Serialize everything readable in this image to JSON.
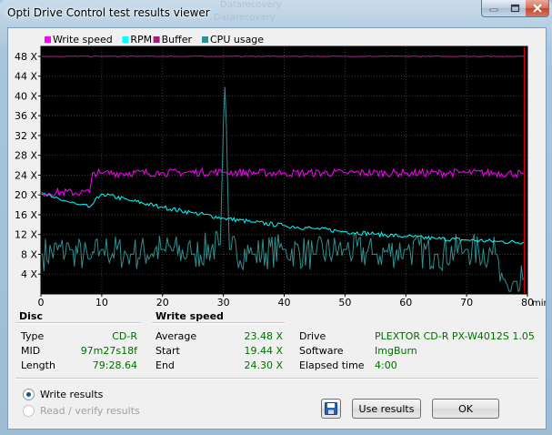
{
  "window": {
    "title": "Opti Drive Control test results viewer",
    "ghost_title_1": "Datarecovery",
    "ghost_title_2": "Datarecovery"
  },
  "chart": {
    "legend": [
      {
        "label": "Write speed",
        "color": "#ff00ff"
      },
      {
        "label": "RPM",
        "color": "#00ffff"
      },
      {
        "label": "Buffer",
        "color": "#a0207f"
      },
      {
        "label": "CPU usage",
        "color": "#2f8f8f"
      }
    ],
    "x_unit": "min",
    "background": "#000000",
    "grid_color": "#3a3a3a",
    "marker_color": "#ff0000"
  },
  "chart_data": {
    "type": "line",
    "x_ticks": [
      "0",
      "10",
      "20",
      "30",
      "40",
      "50",
      "60",
      "70",
      "80"
    ],
    "y_ticks": [
      "4 X",
      "8 X",
      "12 X",
      "16 X",
      "20 X",
      "24 X",
      "28 X",
      "32 X",
      "36 X",
      "40 X",
      "44 X",
      "48 X"
    ],
    "xlim": [
      0,
      80
    ],
    "ylim": [
      0,
      50
    ],
    "grid": true,
    "legend_position": "top-left",
    "series": [
      {
        "name": "Write speed",
        "color": "#ff00ff",
        "x": [
          0,
          8.2,
          8.3,
          10,
          20,
          30,
          40,
          50,
          60,
          70,
          79.5
        ],
        "y": [
          20.5,
          20.5,
          24.5,
          24.4,
          24.5,
          24.6,
          24.4,
          24.5,
          24.4,
          24.5,
          24.3
        ]
      },
      {
        "name": "RPM",
        "color": "#00ffff",
        "x": [
          0,
          2,
          4,
          6,
          8,
          10,
          15,
          20,
          25,
          30,
          35,
          40,
          45,
          50,
          55,
          60,
          65,
          70,
          75,
          79.5
        ],
        "y": [
          20.2,
          19.5,
          18.8,
          18.1,
          17.5,
          20.2,
          18.8,
          17.5,
          16.4,
          15.3,
          14.5,
          13.8,
          13.2,
          12.6,
          12.1,
          11.6,
          11.2,
          10.9,
          10.6,
          10.4
        ]
      },
      {
        "name": "Buffer",
        "color": "#a0207f",
        "x": [
          0,
          10,
          20,
          30,
          40,
          50,
          60,
          70,
          79.5
        ],
        "y": [
          48,
          48,
          48,
          48,
          48,
          48,
          48,
          48,
          48
        ]
      },
      {
        "name": "CPU usage",
        "color": "#2f8f8f",
        "x": [
          0,
          5,
          8,
          10,
          15,
          20,
          25,
          29.5,
          30.2,
          31,
          35,
          40,
          45,
          50,
          55,
          60,
          65,
          70,
          75,
          76,
          78,
          79.5
        ],
        "y": [
          8,
          9,
          7,
          9,
          8,
          9,
          8,
          10,
          44,
          9,
          8,
          9,
          8,
          9,
          8,
          9,
          8,
          9,
          8,
          3,
          2.5,
          3
        ]
      }
    ]
  },
  "disc": {
    "title": "Disc",
    "rows": [
      {
        "label": "Type",
        "value": "CD-R"
      },
      {
        "label": "MID",
        "value": "97m27s18f"
      },
      {
        "label": "Length",
        "value": "79:28.64"
      }
    ]
  },
  "write_speed": {
    "title": "Write speed",
    "rows": [
      {
        "label": "Average",
        "value": "23.48 X"
      },
      {
        "label": "Start",
        "value": "19.44 X"
      },
      {
        "label": "End",
        "value": "24.30 X"
      }
    ]
  },
  "drive_info": {
    "rows": [
      {
        "label": "Drive",
        "value": "PLEXTOR  CD-R   PX-W4012S 1.05"
      },
      {
        "label": "Software",
        "value": "ImgBurn"
      },
      {
        "label": "Elapsed time",
        "value": "4:00"
      }
    ]
  },
  "options": {
    "write_results": "Write results",
    "read_verify_results": "Read / verify results",
    "selected": "write_results"
  },
  "buttons": {
    "save_icon": "floppy-disk-icon",
    "use_results": "Use results",
    "ok": "OK"
  }
}
